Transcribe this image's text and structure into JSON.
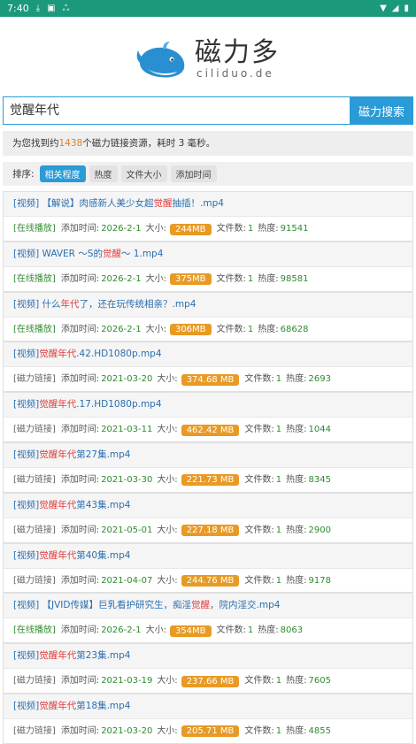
{
  "status": {
    "time": "7:40"
  },
  "logo": {
    "title": "磁力多",
    "subtitle": "ciliduo.de"
  },
  "search": {
    "query": "觉醒年代",
    "button": "磁力搜索"
  },
  "found": {
    "prefix": "为您找到约",
    "count": "1438",
    "suffix": "个磁力链接资源，耗时 3 毫秒。"
  },
  "sort": {
    "label": "排序:",
    "options": [
      "相关程度",
      "热度",
      "文件大小",
      "添加时间"
    ]
  },
  "labels": {
    "added": "添加时间:",
    "size": "大小:",
    "files": "文件数:",
    "heat": "热度:"
  },
  "items": [
    {
      "pre": "[视频] 【解说】肉感新人美少女超",
      "hl": "觉醒",
      "post": "抽插！.mp4",
      "tag": "[在线播放]",
      "date": "2026-2-1",
      "size": "244MB",
      "files": "1",
      "heat": "91541"
    },
    {
      "pre": "[视频] WAVER ～S的",
      "hl": "觉醒",
      "post": "～ 1.mp4",
      "tag": "[在线播放]",
      "date": "2026-2-1",
      "size": "375MB",
      "files": "1",
      "heat": "98581"
    },
    {
      "pre": "[视频] 什么",
      "hl": "年代",
      "post": "了，还在玩传统相亲？.mp4",
      "tag": "[在线播放]",
      "date": "2026-2-1",
      "size": "306MB",
      "files": "1",
      "heat": "68628"
    },
    {
      "pre": "[视频]",
      "hl": "觉醒年代",
      "post": ".42.HD1080p.mp4",
      "tag": "[磁力链接]",
      "date": "2021-03-20",
      "size": "374.68 MB",
      "files": "1",
      "heat": "2693"
    },
    {
      "pre": "[视频]",
      "hl": "觉醒年代",
      "post": ".17.HD1080p.mp4",
      "tag": "[磁力链接]",
      "date": "2021-03-11",
      "size": "462.42 MB",
      "files": "1",
      "heat": "1044"
    },
    {
      "pre": "[视频]",
      "hl": "觉醒年代",
      "post": "第27集.mp4",
      "tag": "[磁力链接]",
      "date": "2021-03-30",
      "size": "221.73 MB",
      "files": "1",
      "heat": "8345"
    },
    {
      "pre": "[视频]",
      "hl": "觉醒年代",
      "post": "第43集.mp4",
      "tag": "[磁力链接]",
      "date": "2021-05-01",
      "size": "227.18 MB",
      "files": "1",
      "heat": "2900"
    },
    {
      "pre": "[视频]",
      "hl": "觉醒年代",
      "post": "第40集.mp4",
      "tag": "[磁力链接]",
      "date": "2021-04-07",
      "size": "244.76 MB",
      "files": "1",
      "heat": "9178"
    },
    {
      "pre": "[视频] 【JVID传媒】巨乳看护研究生，痴淫",
      "hl": "觉醒",
      "post": "，院内淫交.mp4",
      "tag": "[在线播放]",
      "date": "2026-2-1",
      "size": "354MB",
      "files": "1",
      "heat": "8063"
    },
    {
      "pre": "[视频]",
      "hl": "觉醒年代",
      "post": "第23集.mp4",
      "tag": "[磁力链接]",
      "date": "2021-03-19",
      "size": "237.66 MB",
      "files": "1",
      "heat": "7605"
    },
    {
      "pre": "[视频]",
      "hl": "觉醒年代",
      "post": "第18集.mp4",
      "tag": "[磁力链接]",
      "date": "2021-03-20",
      "size": "205.71 MB",
      "files": "1",
      "heat": "4855"
    }
  ]
}
